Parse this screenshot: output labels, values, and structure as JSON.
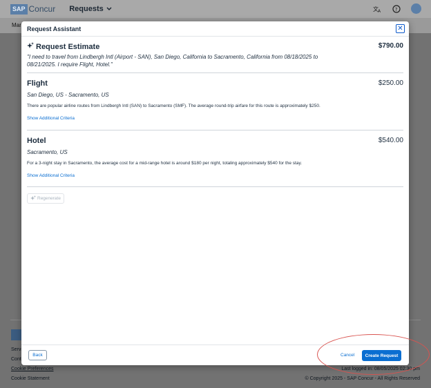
{
  "header": {
    "logo_text": "SAP",
    "brand": "Concur",
    "nav_requests": "Requests",
    "accent": "#0a6ed1"
  },
  "subnav": {
    "label": "Man"
  },
  "footer": {
    "link1": "Servi",
    "link2": "Cont",
    "cookie_prefs": "Cookie Preferences",
    "cookie_statement": "Cookie Statement",
    "last_login": "Last logged in: 08/05/2025 02:30 pm",
    "copyright": "© Copyright 2025 - SAP Concur - All Rights Reserved"
  },
  "modal": {
    "title": "Request Assistant",
    "estimate": {
      "title": "Request Estimate",
      "amount": "$790.00",
      "quote": "\"I need to travel from Lindbergh Intl (Airport - SAN), San Diego, California to Sacramento, California from 08/18/2025 to 08/21/2025. I require Flight, Hotel.\""
    },
    "flight": {
      "title": "Flight",
      "amount": "$250.00",
      "route": "San Diego, US - Sacramento, US",
      "description": "There are popular airline routes from Lindbergh Intl (SAN) to Sacramento (SMF). The average round-trip airfare for this route is approximately $250.",
      "link": "Show Additional Criteria"
    },
    "hotel": {
      "title": "Hotel",
      "amount": "$540.00",
      "location": "Sacramento, US",
      "description": "For a 3-night stay in Sacramento, the average cost for a mid-range hotel is around $180 per night, totaling approximately $540 for the stay.",
      "link": "Show Additional Criteria"
    },
    "regenerate_label": "Regenerate",
    "back_label": "Back",
    "cancel_label": "Cancel",
    "create_label": "Create Request"
  }
}
